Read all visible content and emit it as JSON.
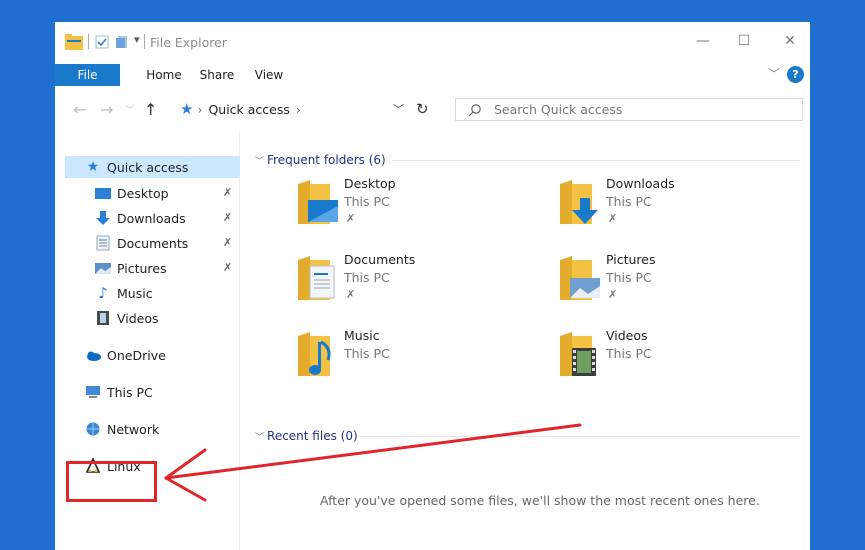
{
  "window": {
    "title": "File Explorer",
    "controls": {
      "minimize": "—",
      "maximize": "☐",
      "close": "✕"
    }
  },
  "ribbon": {
    "tabs": [
      "File",
      "Home",
      "Share",
      "View"
    ],
    "help": "?"
  },
  "address": {
    "path": "Quick access",
    "separator": "›",
    "search_placeholder": "Search Quick access"
  },
  "nav": {
    "quick_access": "Quick access",
    "pinned": [
      {
        "label": "Desktop",
        "pinned": true
      },
      {
        "label": "Downloads",
        "pinned": true
      },
      {
        "label": "Documents",
        "pinned": true
      },
      {
        "label": "Pictures",
        "pinned": true
      },
      {
        "label": "Music",
        "pinned": false
      },
      {
        "label": "Videos",
        "pinned": false
      }
    ],
    "onedrive": "OneDrive",
    "this_pc": "This PC",
    "network": "Network",
    "linux": "Linux",
    "pin_glyph": "✗"
  },
  "frequent": {
    "header": "Frequent folders (6)",
    "folders": [
      {
        "name": "Desktop",
        "location": "This PC",
        "pinned": true
      },
      {
        "name": "Downloads",
        "location": "This PC",
        "pinned": true
      },
      {
        "name": "Documents",
        "location": "This PC",
        "pinned": true
      },
      {
        "name": "Pictures",
        "location": "This PC",
        "pinned": true
      },
      {
        "name": "Music",
        "location": "This PC",
        "pinned": false
      },
      {
        "name": "Videos",
        "location": "This PC",
        "pinned": false
      }
    ]
  },
  "recent": {
    "header": "Recent files (0)",
    "empty_message": "After you've opened some files, we'll show the most recent ones here."
  },
  "colors": {
    "accent": "#1979ca",
    "selection": "#cce8ff",
    "annotation": "#e0262a",
    "folder": "#f3c144"
  }
}
